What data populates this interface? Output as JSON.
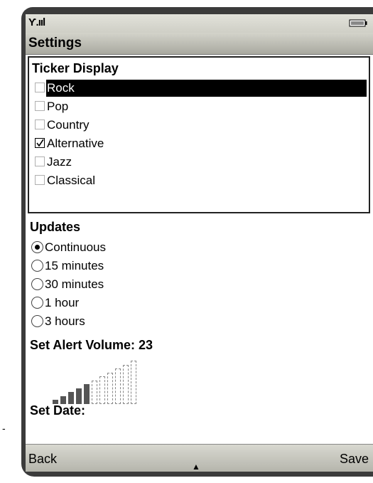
{
  "status": {
    "signal_glyph": "Ƴ.ııl",
    "signal_icon": "signal-strength-icon",
    "battery_icon": "battery-icon"
  },
  "title": "Settings",
  "ticker": {
    "label": "Ticker Display",
    "items": [
      {
        "label": "Rock",
        "checked": false,
        "selected": true
      },
      {
        "label": "Pop",
        "checked": false,
        "selected": false
      },
      {
        "label": "Country",
        "checked": false,
        "selected": false
      },
      {
        "label": "Alternative",
        "checked": true,
        "selected": false
      },
      {
        "label": "Jazz",
        "checked": false,
        "selected": false
      },
      {
        "label": "Classical",
        "checked": false,
        "selected": false
      }
    ]
  },
  "updates": {
    "label": "Updates",
    "options": [
      {
        "label": "Continuous",
        "selected": true
      },
      {
        "label": "15 minutes",
        "selected": false
      },
      {
        "label": "30 minutes",
        "selected": false
      },
      {
        "label": "1 hour",
        "selected": false
      },
      {
        "label": "3 hours",
        "selected": false
      }
    ]
  },
  "volume": {
    "label": "Set Alert Volume: 23",
    "level_filled": 5,
    "level_total": 11
  },
  "date": {
    "label": "Set Date:"
  },
  "softkeys": {
    "left": "Back",
    "right": "Save"
  },
  "scroll_indicator": "▲",
  "margin_mark": "-"
}
